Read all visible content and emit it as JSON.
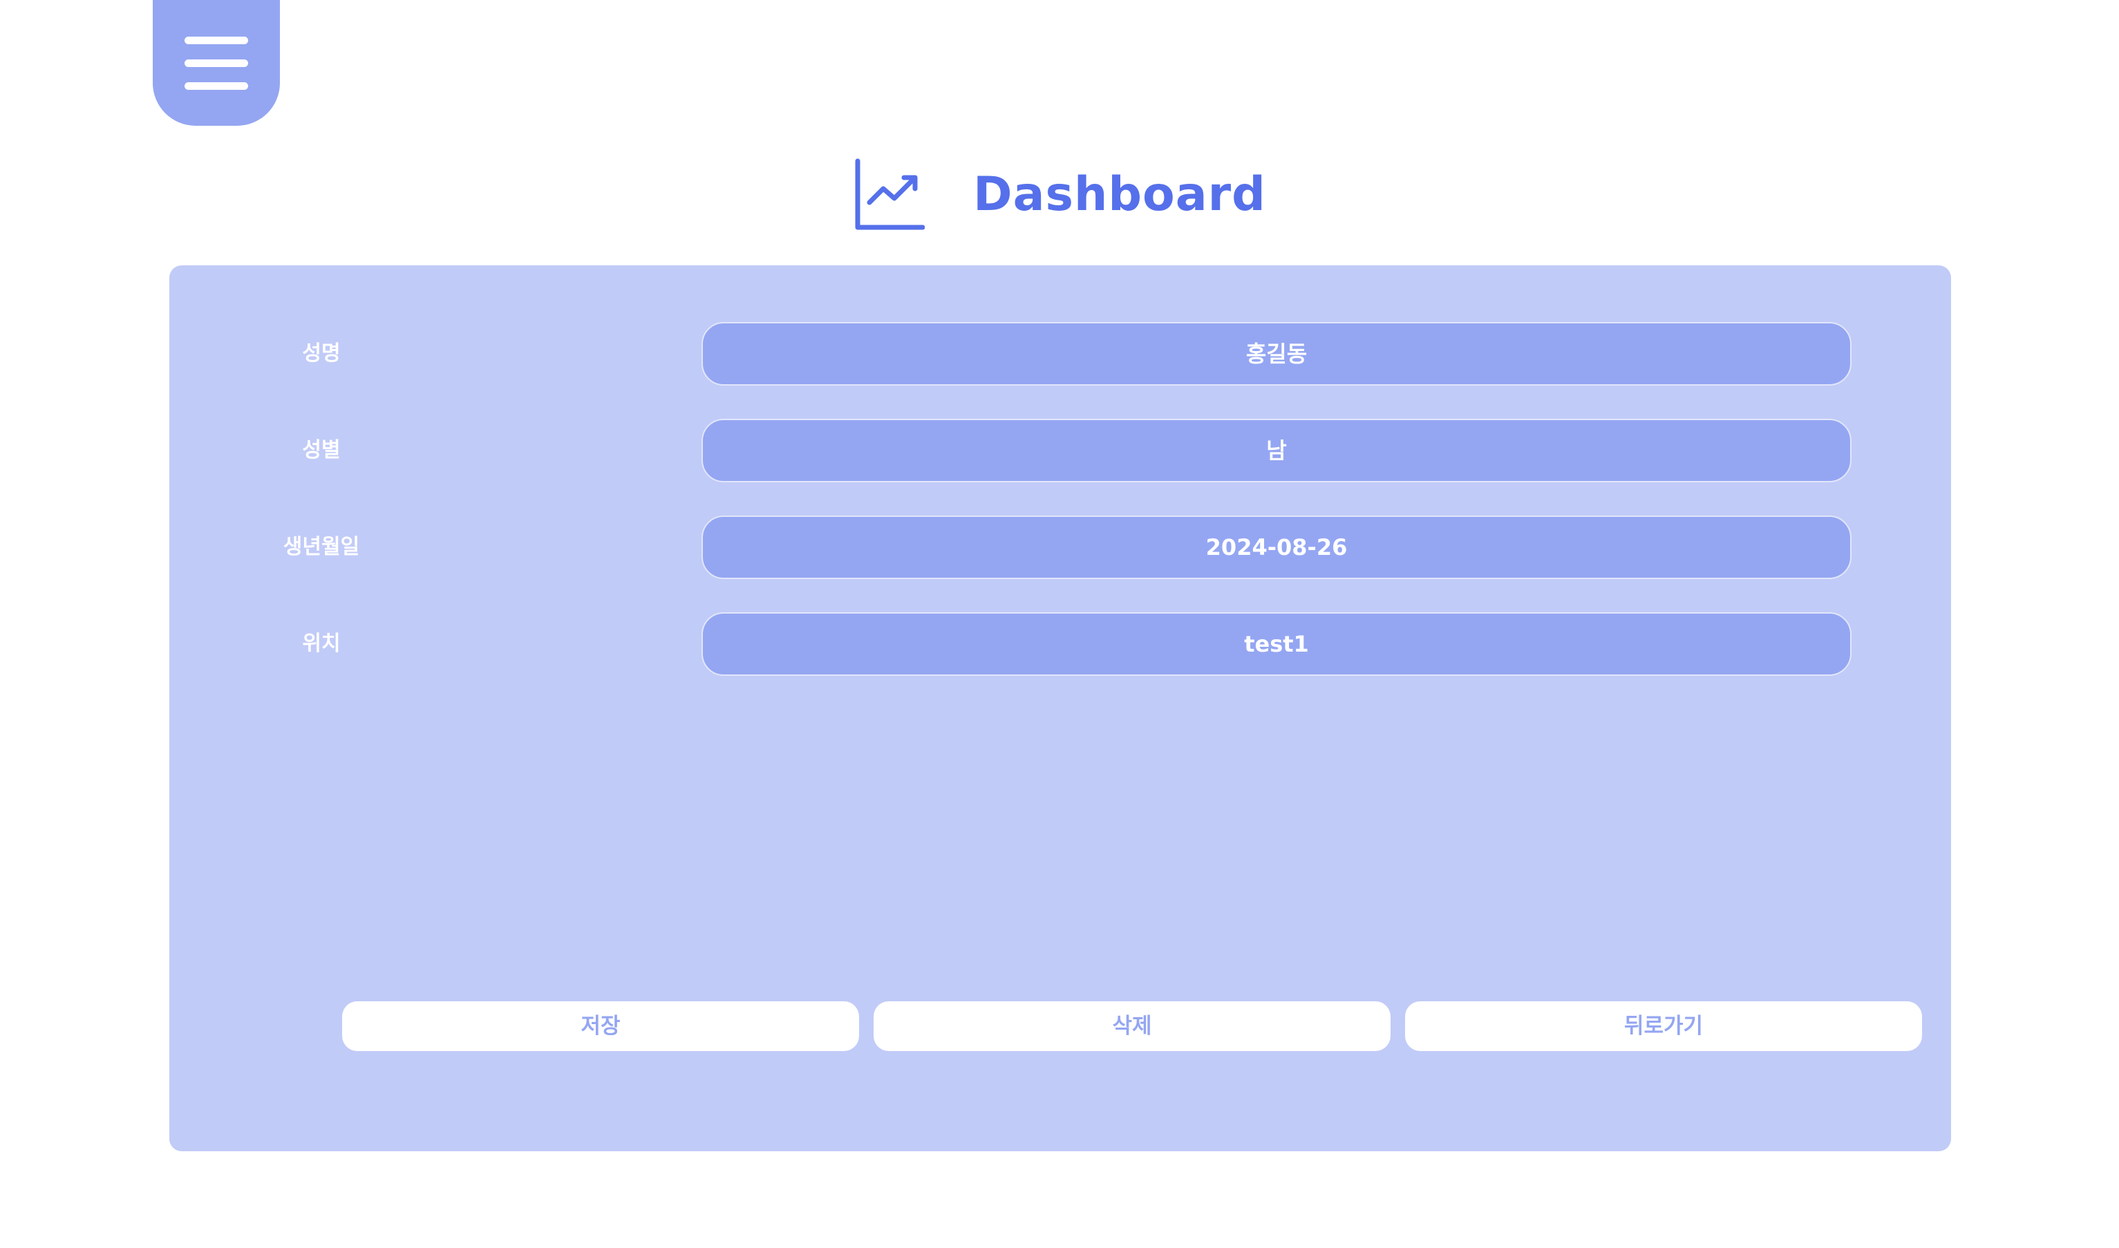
{
  "header": {
    "title": "Dashboard",
    "icon": "chart-line-icon"
  },
  "menu": {
    "icon": "hamburger-menu-icon"
  },
  "form": {
    "fields": [
      {
        "label": "성명",
        "value": "홍길동"
      },
      {
        "label": "성별",
        "value": "남"
      },
      {
        "label": "생년월일",
        "value": "2024-08-26"
      },
      {
        "label": "위치",
        "value": "test1"
      }
    ]
  },
  "actions": {
    "save_label": "저장",
    "delete_label": "삭제",
    "back_label": "뒤로가기"
  },
  "colors": {
    "accent": "#5570ea",
    "menu_bg": "#94a6f2",
    "panel_bg": "#c1cbf7",
    "field_bg": "#94a6f2",
    "button_bg": "#ffffff",
    "button_text": "#94a6f2"
  }
}
